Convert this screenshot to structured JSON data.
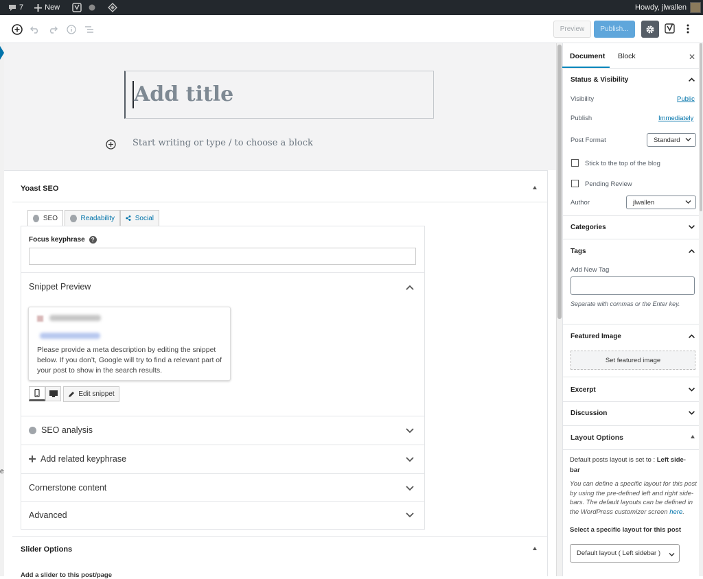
{
  "admin_bar": {
    "comments_count": "7",
    "new_label": "New",
    "howdy": "Howdy, jlwallen"
  },
  "toolbar": {
    "preview_label": "Preview",
    "publish_label": "Publish..."
  },
  "editor": {
    "title_placeholder": "Add title",
    "block_placeholder": "Start writing or type / to choose a block"
  },
  "yoast": {
    "header": "Yoast SEO",
    "tabs": [
      {
        "label": "SEO"
      },
      {
        "label": "Readability"
      },
      {
        "label": "Social"
      }
    ],
    "focus_keyphrase_label": "Focus keyphrase",
    "focus_keyphrase_value": "",
    "snippet_preview_label": "Snippet Preview",
    "snippet_text": "Please provide a meta description by editing the snippet below. If you don’t, Google will try to find a relevant part of your post to show in the search results.",
    "edit_snippet_label": "Edit snippet",
    "sections": [
      {
        "label": "SEO analysis"
      },
      {
        "label": "Add related keyphrase"
      },
      {
        "label": "Cornerstone content"
      },
      {
        "label": "Advanced"
      }
    ]
  },
  "slider": {
    "header": "Slider Options",
    "sub": "Add a slider to this post/page"
  },
  "sidebar": {
    "tab_document": "Document",
    "tab_block": "Block",
    "status_header": "Status & Visibility",
    "visibility_label": "Visibility",
    "visibility_value": "Public",
    "publish_label": "Publish",
    "publish_value": "Immediately",
    "post_format_label": "Post Format",
    "post_format_value": "Standard",
    "stick_label": "Stick to the top of the blog",
    "pending_label": "Pending Review",
    "author_label": "Author",
    "author_value": "jlwallen",
    "categories_header": "Categories",
    "tags_header": "Tags",
    "add_tag_label": "Add New Tag",
    "tag_hint": "Separate with commas or the Enter key.",
    "featured_header": "Featured Image",
    "featured_button": "Set featured image",
    "excerpt_header": "Excerpt",
    "discussion_header": "Discussion",
    "layout_header": "Layout Options",
    "layout_default_prefix": "Default posts layout is set to : ",
    "layout_default_value": "Left side-bar",
    "layout_desc": "You can define a specific layout for this post by using the pre-defined left and right side-bars. The default layouts can be defined in the WordPress customizer screen ",
    "layout_desc_link": "here",
    "layout_select_label": "Select a specific layout for this post",
    "layout_select_value": "Default layout ( Left sidebar )"
  },
  "colors": {
    "admin_bar": "#23282d",
    "link": "#0073aa",
    "publish": "#5fa6db",
    "accent": "#0085ba"
  },
  "icons": [
    "comment-icon",
    "plus-icon",
    "yoast-icon",
    "circle-icon",
    "diamond-icon",
    "add-block-icon",
    "undo-icon",
    "redo-icon",
    "info-icon",
    "outline-icon",
    "gear-icon",
    "more-vertical-icon",
    "chevron-up-icon",
    "chevron-down-icon",
    "help-icon",
    "share-icon",
    "pencil-icon",
    "mobile-icon",
    "desktop-icon",
    "close-icon"
  ]
}
